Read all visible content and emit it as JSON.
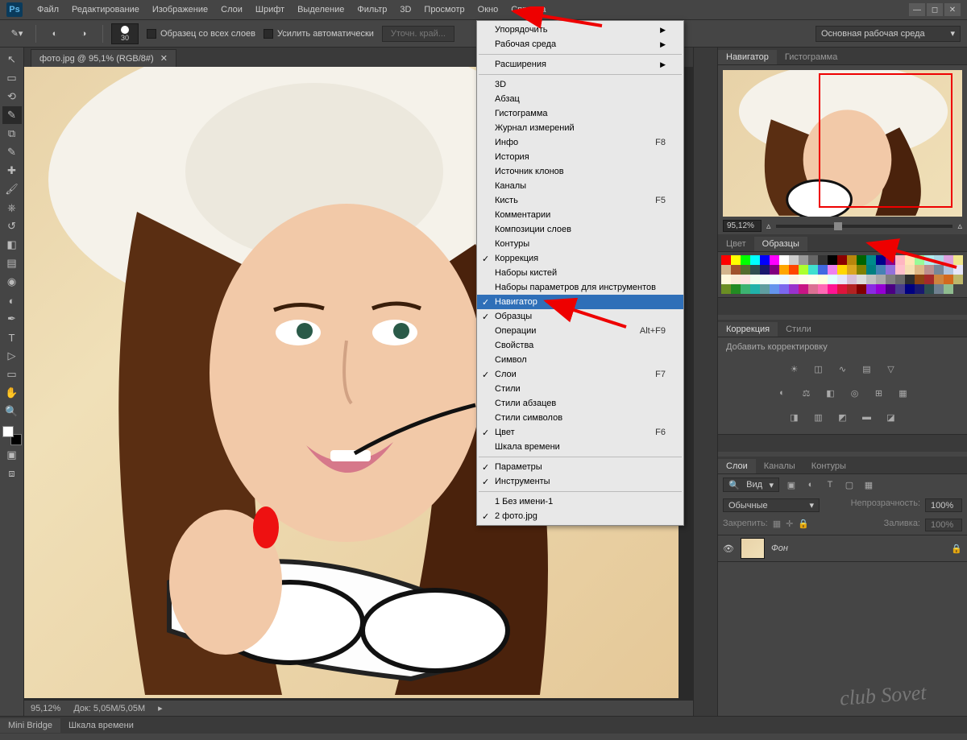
{
  "menubar": [
    "Файл",
    "Редактирование",
    "Изображение",
    "Слои",
    "Шрифт",
    "Выделение",
    "Фильтр",
    "3D",
    "Просмотр",
    "Окно",
    "Справка"
  ],
  "options": {
    "brush_size": "30",
    "chk1": "Образец со всех слоев",
    "chk2": "Усилить автоматически",
    "btn_disabled": "Уточн. край...",
    "workspace": "Основная рабочая среда"
  },
  "doc_tab": "фото.jpg @ 95,1% (RGB/8#)",
  "status": {
    "zoom": "95,12%",
    "doc": "Док: 5,05M/5,05M"
  },
  "bottom_tabs": [
    "Mini Bridge",
    "Шкала времени"
  ],
  "dropdown": {
    "groups": [
      [
        {
          "t": "Упорядочить",
          "sub": true
        },
        {
          "t": "Рабочая среда",
          "sub": true
        }
      ],
      [
        {
          "t": "Расширения",
          "sub": true
        }
      ],
      [
        {
          "t": "3D"
        },
        {
          "t": "Абзац"
        },
        {
          "t": "Гистограмма"
        },
        {
          "t": "Журнал измерений"
        },
        {
          "t": "Инфо",
          "sc": "F8"
        },
        {
          "t": "История"
        },
        {
          "t": "Источник клонов"
        },
        {
          "t": "Каналы"
        },
        {
          "t": "Кисть",
          "sc": "F5"
        },
        {
          "t": "Комментарии"
        },
        {
          "t": "Композиции слоев"
        },
        {
          "t": "Контуры"
        },
        {
          "t": "Коррекция",
          "chk": true
        },
        {
          "t": "Наборы кистей"
        },
        {
          "t": "Наборы параметров для инструментов"
        },
        {
          "t": "Навигатор",
          "chk": true,
          "hl": true
        },
        {
          "t": "Образцы",
          "chk": true
        },
        {
          "t": "Операции",
          "sc": "Alt+F9"
        },
        {
          "t": "Свойства"
        },
        {
          "t": "Символ"
        },
        {
          "t": "Слои",
          "chk": true,
          "sc": "F7"
        },
        {
          "t": "Стили"
        },
        {
          "t": "Стили абзацев"
        },
        {
          "t": "Стили символов"
        },
        {
          "t": "Цвет",
          "chk": true,
          "sc": "F6"
        },
        {
          "t": "Шкала времени"
        }
      ],
      [
        {
          "t": "Параметры",
          "chk": true
        },
        {
          "t": "Инструменты",
          "chk": true
        }
      ],
      [
        {
          "t": "1 Без имени-1"
        },
        {
          "t": "2 фото.jpg",
          "chk": true
        }
      ]
    ]
  },
  "panels": {
    "navigator": {
      "tabs": [
        "Навигатор",
        "Гистограмма"
      ],
      "zoom": "95,12%"
    },
    "color": {
      "tabs": [
        "Цвет",
        "Образцы"
      ]
    },
    "adjust": {
      "tabs": [
        "Коррекция",
        "Стили"
      ],
      "title": "Добавить корректировку"
    },
    "layers": {
      "tabs": [
        "Слои",
        "Каналы",
        "Контуры"
      ],
      "kind": "Вид",
      "blend": "Обычные",
      "opacity_label": "Непрозрачность:",
      "opacity": "100%",
      "lock_label": "Закрепить:",
      "fill_label": "Заливка:",
      "fill": "100%",
      "layer_name": "Фон"
    }
  },
  "swatch_colors": [
    "#ff0000",
    "#ffff00",
    "#00ff00",
    "#00ffff",
    "#0000ff",
    "#ff00ff",
    "#ffffff",
    "#cccccc",
    "#999999",
    "#666666",
    "#333333",
    "#000000",
    "#8b0000",
    "#b8860b",
    "#006400",
    "#008b8b",
    "#00008b",
    "#8b008b",
    "#ffb6c1",
    "#ffe4b5",
    "#98fb98",
    "#afeeee",
    "#add8e6",
    "#dda0dd",
    "#f0e68c",
    "#d2b48c",
    "#a0522d",
    "#556b2f",
    "#2f4f4f",
    "#191970",
    "#800080",
    "#ffa500",
    "#ff4500",
    "#adff2f",
    "#40e0d0",
    "#4169e1",
    "#ee82ee",
    "#ffd700",
    "#daa520",
    "#808000",
    "#008080",
    "#4682b4",
    "#9370db",
    "#ffc0cb",
    "#f5deb3",
    "#deb887",
    "#bc8f8f",
    "#778899",
    "#b0c4de",
    "#e6e6fa",
    "#fff8dc",
    "#faebd7",
    "#ffe4e1",
    "#f0fff0",
    "#f5fffa",
    "#f0ffff",
    "#f0f8ff",
    "#fdf5e6",
    "#fffaf0",
    "#fffff0",
    "#ffffe0",
    "#e0ffff",
    "#e6e6fa",
    "#d8bfd8",
    "#dcdcdc",
    "#c0c0c0",
    "#a9a9a9",
    "#808080",
    "#696969",
    "#2e2e2e",
    "#8b4513",
    "#a52a2a",
    "#cd853f",
    "#d2691e",
    "#bdb76b",
    "#6b8e23",
    "#228b22",
    "#3cb371",
    "#20b2aa",
    "#5f9ea0",
    "#6495ed",
    "#7b68ee",
    "#9932cc",
    "#c71585",
    "#db7093",
    "#ff69b4",
    "#ff1493",
    "#dc143c",
    "#b22222",
    "#800000",
    "#8a2be2",
    "#9400d3",
    "#4b0082",
    "#483d8b",
    "#000080",
    "#191970",
    "#2f4f4f",
    "#708090",
    "#8fbc8f"
  ],
  "watermark": "club Sovet"
}
